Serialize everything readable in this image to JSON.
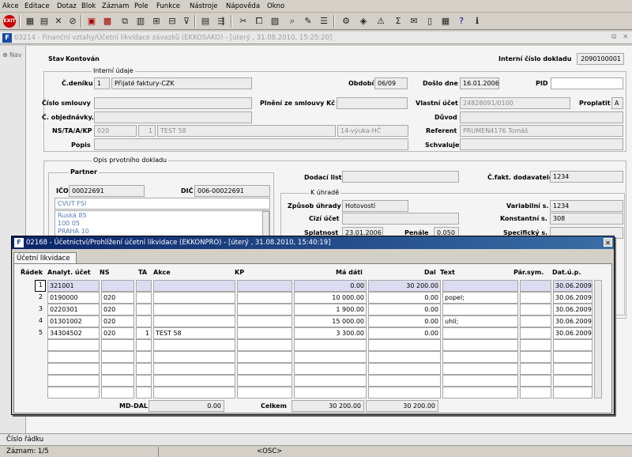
{
  "menu": [
    "Akce",
    "Editace",
    "Dotaz",
    "Blok",
    "Záznam",
    "Pole",
    "Funkce",
    "Nástroje",
    "Nápověda",
    "Okno"
  ],
  "bg_window_title": "03214 - Finanční vztahy/Účetní likvidace závazků (EKKOSAKO) - [úterý , 31.08.2010, 15:25:20]",
  "nav_label": "Nav",
  "form": {
    "stav_label": "Stav",
    "stav_value": "Kontován",
    "icd_label": "Interní číslo dokladu",
    "icd_value": "2090100001",
    "interni_udaje": "Interní údaje",
    "cdeniku_label": "Č.deníku",
    "cdeniku_num": "1",
    "cdeniku_text": "Přijaté faktury-CZK",
    "obdobi_label": "Období",
    "obdobi_value": "06/09",
    "doslo_label": "Došlo dne",
    "doslo_value": "16.01.2006",
    "pid_label": "PID",
    "pid_value": "",
    "cislo_smlouvy_label": "Číslo smlouvy",
    "plneni_label": "Plnění ze smlouvy Kč",
    "vlastni_ucet_label": "Vlastní účet",
    "vlastni_ucet_value": "24828091/0100",
    "proplatit_label": "Proplatit",
    "proplatit_value": "A",
    "cobj_label": "Č. objednávky.",
    "duvod_label": "Důvod",
    "nstakp_label": "NS/TA/A/KP",
    "ns_value": "020",
    "ta_value": "1",
    "a_value": "TEST 58",
    "kp_value": "14-výuka-HČ",
    "referent_label": "Referent",
    "referent_value": "PRUMEN4176 Tomáš",
    "popis_label": "Popis",
    "schvaluje_label": "Schvaluje",
    "opis_label": "Opis prvotního dokladu",
    "partner_label": "Partner",
    "ico_label": "IČO",
    "ico_value": "00022691",
    "dic_label": "DIČ",
    "dic_value": "006-00022691",
    "partner_name": "CVUT FSI",
    "address_lines": [
      "Ruská 85",
      "100 05",
      "PRAHA 10"
    ],
    "dodaci_label": "Dodací list",
    "cfakt_label": "Č.fakt. dodavatele",
    "cfakt_value": "1234",
    "k_uhrade_label": "K úhradě",
    "zpusob_label": "Způsob úhrady",
    "zpusob_value": "Hotovostí",
    "cizi_label": "Cizí účet",
    "splatnost_label": "Splatnost",
    "splatnost_value": "23.01.2006",
    "penale_label": "Penále",
    "penale_value": "0.050",
    "var_label": "Variabilní s.",
    "var_value": "1234",
    "konst_label": "Konstantní s.",
    "konst_value": "308",
    "spec_label": "Specifický s."
  },
  "dialog": {
    "title": "02168 - Účetnictví/Prohlížení účetní likvidace (EKKONPRO) - [úterý , 31.08.2010, 15:40:19]",
    "tab": "Účetní likvidace",
    "headers": [
      "Řádek",
      "Analyt. účet",
      "NS",
      "TA",
      "Akce",
      "KP",
      "Má dáti",
      "Dal",
      "Text",
      "Pár.sym.",
      "Dat.ú.p."
    ],
    "rows": [
      {
        "n": "1",
        "ucet": "321001",
        "ns": "",
        "ta": "",
        "akce": "",
        "kp": "",
        "madati": "0.00",
        "dal": "30 200.00",
        "text": "",
        "par": "",
        "dat": "30.06.2009"
      },
      {
        "n": "2",
        "ucet": "0190000",
        "ns": "020",
        "ta": "",
        "akce": "",
        "kp": "",
        "madati": "10 000.00",
        "dal": "0.00",
        "text": "popel;",
        "par": "",
        "dat": "30.06.2009"
      },
      {
        "n": "3",
        "ucet": "0220301",
        "ns": "020",
        "ta": "",
        "akce": "",
        "kp": "",
        "madati": "1 900.00",
        "dal": "0.00",
        "text": "",
        "par": "",
        "dat": "30.06.2009"
      },
      {
        "n": "4",
        "ucet": "01301002",
        "ns": "020",
        "ta": "",
        "akce": "",
        "kp": "",
        "madati": "15 000.00",
        "dal": "0.00",
        "text": "uhlí;",
        "par": "",
        "dat": "30.06.2009"
      },
      {
        "n": "5",
        "ucet": "34304502",
        "ns": "020",
        "ta": "1",
        "akce": "TEST 58",
        "kp": "",
        "madati": "3 300.00",
        "dal": "0.00",
        "text": "",
        "par": "",
        "dat": "30.06.2009"
      }
    ],
    "empty_rows": 5,
    "mddal_label": "MD-DAL",
    "mddal_value": "0.00",
    "celkem_label": "Celkem",
    "celkem_madati": "30 200.00",
    "celkem_dal": "30 200.00"
  },
  "status": {
    "line1": "Číslo řádku",
    "line2": "Záznam: 1/5",
    "osc": "<OSC>"
  },
  "colors": {
    "title_bar": "#0a246a",
    "form_bg": "#f4f4f4",
    "chrome": "#d4d0c8"
  }
}
